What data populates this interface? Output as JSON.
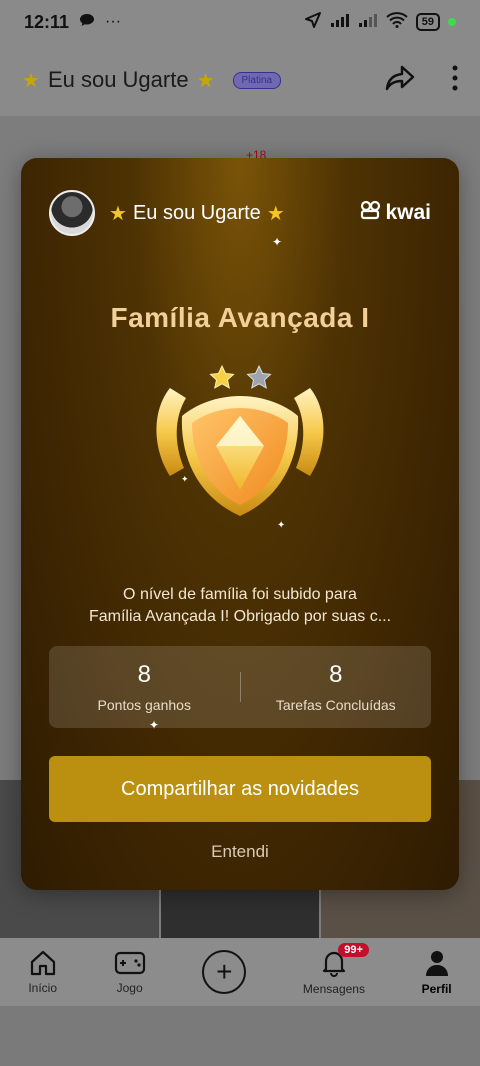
{
  "status_bar": {
    "time": "12:11",
    "battery": "59",
    "more": "···"
  },
  "header": {
    "title": "Eu sou Ugarte",
    "badge": "Platina"
  },
  "background": {
    "count_badge": "+18"
  },
  "modal": {
    "user_name": "Eu sou Ugarte",
    "brand": "kwai",
    "level_title": "Família Avançada I",
    "description_line1": "O nível de família foi subido para",
    "description_line2": "Família Avançada I! Obrigado por suas c...",
    "stats": [
      {
        "value": "8",
        "label": "Pontos ganhos"
      },
      {
        "value": "8",
        "label": "Tarefas Concluídas"
      }
    ],
    "share_button": "Compartilhar as novidades",
    "dismiss": "Entendi",
    "stars_earned": 1,
    "stars_total": 2
  },
  "bottom_nav": {
    "items": [
      {
        "label": "Início",
        "icon": "home-icon"
      },
      {
        "label": "Jogo",
        "icon": "gamepad-icon"
      },
      {
        "label": "",
        "icon": "plus-icon"
      },
      {
        "label": "Mensagens",
        "icon": "bell-icon",
        "badge": "99+"
      },
      {
        "label": "Perfil",
        "icon": "person-icon"
      }
    ]
  },
  "colors": {
    "modal_gold": "#bb8f0f",
    "title_gold": "#f3cf9a",
    "notif_red": "#c2102c"
  }
}
